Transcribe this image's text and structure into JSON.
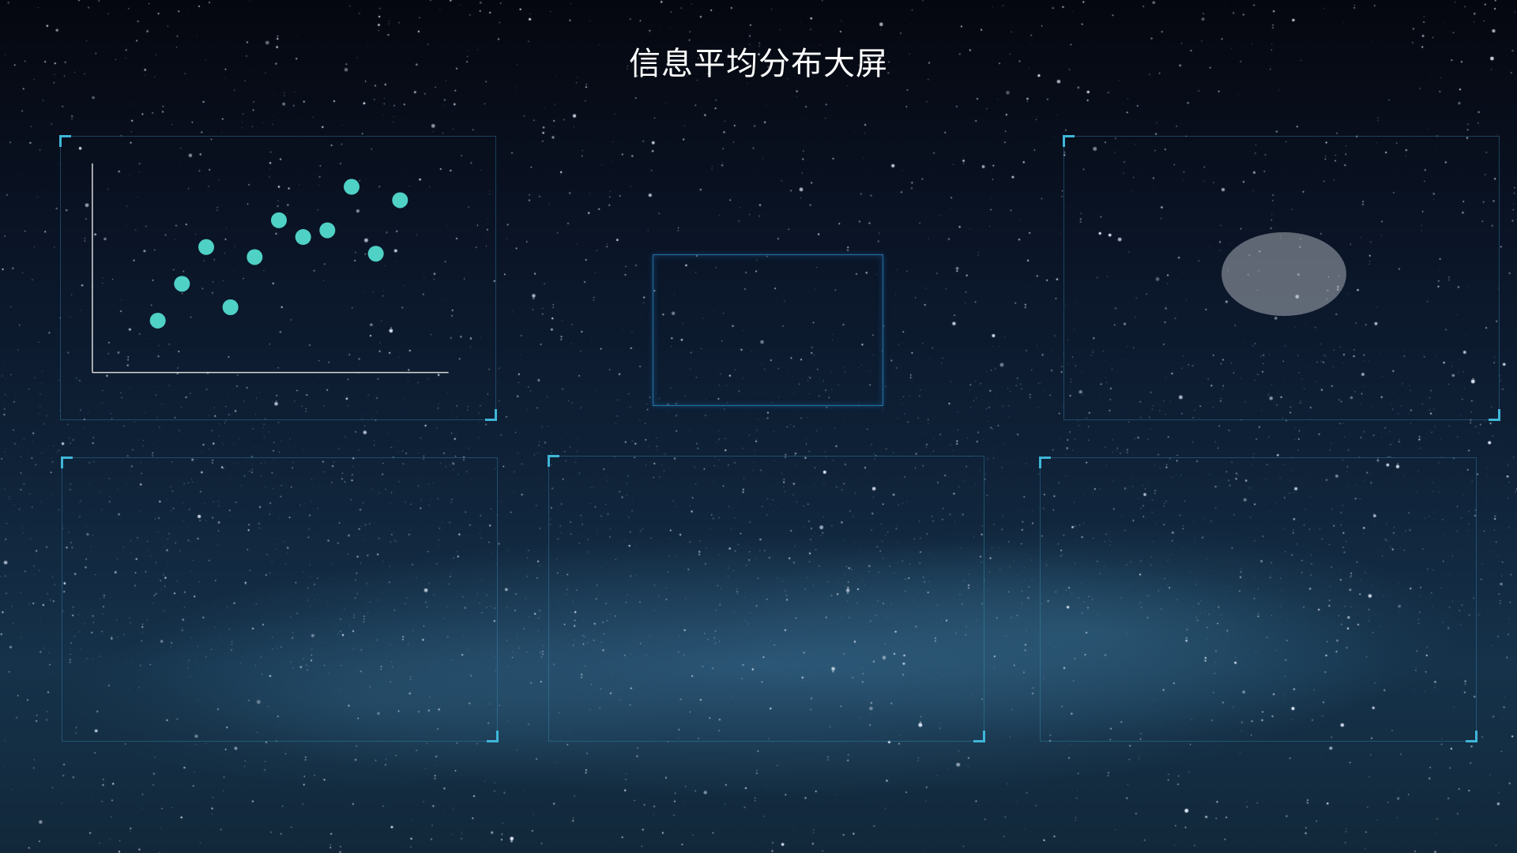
{
  "title": "信息平均分布大屏",
  "colors": {
    "frame": "#3fb6d8",
    "point": "#4fd1c5",
    "axis": "#d8d8d8",
    "ellipse": "#c8cdd2"
  },
  "chart_data": {
    "type": "scatter",
    "points": [
      {
        "x": 1,
        "y": 1.0
      },
      {
        "x": 2,
        "y": 2.1
      },
      {
        "x": 3,
        "y": 3.2
      },
      {
        "x": 4,
        "y": 1.4
      },
      {
        "x": 5,
        "y": 2.9
      },
      {
        "x": 6,
        "y": 4.0
      },
      {
        "x": 7,
        "y": 3.5
      },
      {
        "x": 8,
        "y": 3.7
      },
      {
        "x": 9,
        "y": 5.0
      },
      {
        "x": 10,
        "y": 3.0
      },
      {
        "x": 11,
        "y": 4.6
      }
    ],
    "xlim": [
      -3,
      15
    ],
    "ylim": [
      -2,
      6.5
    ],
    "grid": false,
    "title": "",
    "xlabel": "",
    "ylabel": ""
  }
}
